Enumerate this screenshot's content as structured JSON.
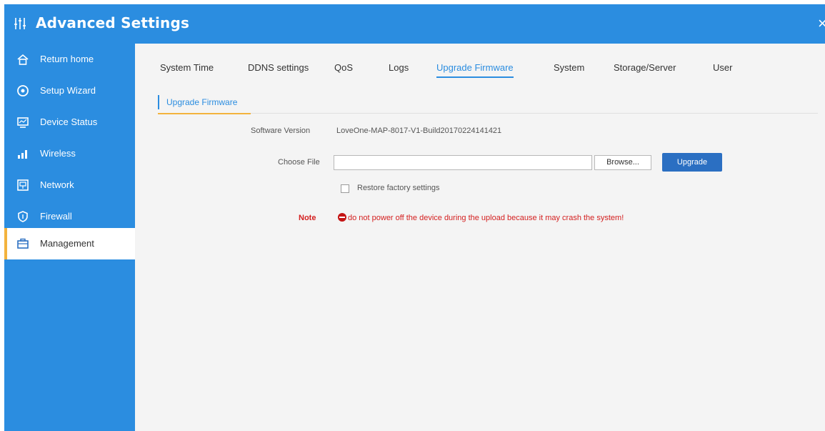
{
  "window": {
    "title": "Advanced Settings",
    "close_glyph": "×"
  },
  "sidebar": {
    "items": [
      {
        "label": "Return home",
        "icon": "home-icon"
      },
      {
        "label": "Setup Wizard",
        "icon": "wizard-icon"
      },
      {
        "label": "Device Status",
        "icon": "monitor-icon"
      },
      {
        "label": "Wireless",
        "icon": "signal-icon"
      },
      {
        "label": "Network",
        "icon": "network-icon"
      },
      {
        "label": "Firewall",
        "icon": "shield-icon"
      },
      {
        "label": "Management",
        "icon": "briefcase-icon",
        "active": true
      }
    ]
  },
  "tabs": [
    {
      "label": "System Time"
    },
    {
      "label": "DDNS settings"
    },
    {
      "label": "QoS"
    },
    {
      "label": "Logs"
    },
    {
      "label": "Upgrade Firmware",
      "active": true
    },
    {
      "label": "System"
    },
    {
      "label": "Storage/Server"
    },
    {
      "label": "User"
    }
  ],
  "section": {
    "title": "Upgrade Firmware"
  },
  "form": {
    "software_version_label": "Software Version",
    "software_version_value": "LoveOne-MAP-8017-V1-Build20170224141421",
    "choose_file_label": "Choose File",
    "file_value": "",
    "browse_label": "Browse...",
    "upgrade_label": "Upgrade",
    "restore_label": "Restore factory settings",
    "restore_checked": false,
    "note_label": "Note",
    "note_text": "do not power off the device during the upload because it may crash the system!"
  },
  "colors": {
    "brand": "#2b8de0",
    "accent": "#f3b33d",
    "warning": "#d42020",
    "button": "#2b6fc2"
  }
}
